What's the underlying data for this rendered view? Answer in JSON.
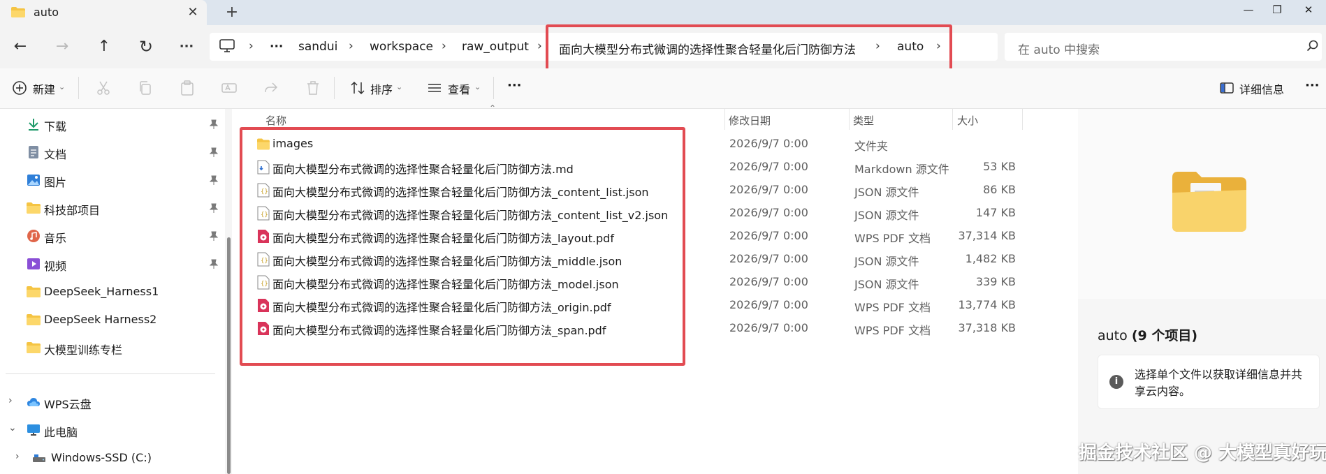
{
  "tab": {
    "title": "auto",
    "close": "✕",
    "new": "+"
  },
  "window": {
    "minimize": "—",
    "maximize": "❐",
    "close": "✕"
  },
  "nav": {
    "back": "←",
    "forward": "→",
    "up": "↑",
    "refresh": "↻",
    "more": "···"
  },
  "breadcrumb": {
    "more": "···",
    "items": [
      "sandui",
      "workspace",
      "raw_output",
      "面向大模型分布式微调的选择性聚合轻量化后门防御方法",
      "auto"
    ]
  },
  "search": {
    "placeholder": "在 auto 中搜索"
  },
  "commandbar": {
    "new_label": "新建",
    "sort_label": "排序",
    "view_label": "查看",
    "more": "···",
    "details_label": "详细信息",
    "details_more": "···"
  },
  "sidebar": {
    "quick": [
      {
        "label": "下载",
        "icon": "download-icon",
        "pinned": true
      },
      {
        "label": "文档",
        "icon": "document-icon",
        "pinned": true
      },
      {
        "label": "图片",
        "icon": "picture-icon",
        "pinned": true
      },
      {
        "label": "科技部项目",
        "icon": "folder-icon",
        "pinned": true
      },
      {
        "label": "音乐",
        "icon": "music-icon",
        "pinned": true
      },
      {
        "label": "视频",
        "icon": "video-icon",
        "pinned": true
      },
      {
        "label": "DeepSeek_Harness1",
        "icon": "folder-icon",
        "pinned": false
      },
      {
        "label": "DeepSeek Harness2",
        "icon": "folder-icon",
        "pinned": false
      },
      {
        "label": "大模型训练专栏",
        "icon": "folder-icon",
        "pinned": false
      }
    ],
    "wps_cloud": "WPS云盘",
    "this_pc": "此电脑",
    "drive_c": "Windows-SSD (C:)"
  },
  "filelist": {
    "headers": {
      "name": "名称",
      "date": "修改日期",
      "type": "类型",
      "size": "大小"
    },
    "rows": [
      {
        "name": "images",
        "date": "2026/9/7 0:00",
        "type": "文件夹",
        "size": "",
        "kind": "folder"
      },
      {
        "name": "面向大模型分布式微调的选择性聚合轻量化后门防御方法.md",
        "date": "2026/9/7 0:00",
        "type": "Markdown 源文件",
        "size": "53 KB",
        "kind": "md"
      },
      {
        "name": "面向大模型分布式微调的选择性聚合轻量化后门防御方法_content_list.json",
        "date": "2026/9/7 0:00",
        "type": "JSON 源文件",
        "size": "86 KB",
        "kind": "json"
      },
      {
        "name": "面向大模型分布式微调的选择性聚合轻量化后门防御方法_content_list_v2.json",
        "date": "2026/9/7 0:00",
        "type": "JSON 源文件",
        "size": "147 KB",
        "kind": "json"
      },
      {
        "name": "面向大模型分布式微调的选择性聚合轻量化后门防御方法_layout.pdf",
        "date": "2026/9/7 0:00",
        "type": "WPS PDF 文档",
        "size": "37,314 KB",
        "kind": "pdf"
      },
      {
        "name": "面向大模型分布式微调的选择性聚合轻量化后门防御方法_middle.json",
        "date": "2026/9/7 0:00",
        "type": "JSON 源文件",
        "size": "1,482 KB",
        "kind": "json"
      },
      {
        "name": "面向大模型分布式微调的选择性聚合轻量化后门防御方法_model.json",
        "date": "2026/9/7 0:00",
        "type": "JSON 源文件",
        "size": "339 KB",
        "kind": "json"
      },
      {
        "name": "面向大模型分布式微调的选择性聚合轻量化后门防御方法_origin.pdf",
        "date": "2026/9/7 0:00",
        "type": "WPS PDF 文档",
        "size": "13,774 KB",
        "kind": "pdf"
      },
      {
        "name": "面向大模型分布式微调的选择性聚合轻量化后门防御方法_span.pdf",
        "date": "2026/9/7 0:00",
        "type": "WPS PDF 文档",
        "size": "37,318 KB",
        "kind": "pdf"
      }
    ]
  },
  "details": {
    "title_name": "auto",
    "title_count": "(9 个项目)",
    "info": "i",
    "message": "选择单个文件以获取详细信息并共享云内容。"
  },
  "watermark": "掘金技术社区 @ 大模型真好玩",
  "colors": {
    "folder": "#f5c443",
    "highlight": "#e24b52",
    "pdf": "#d9345a",
    "accent": "#0067c0"
  }
}
